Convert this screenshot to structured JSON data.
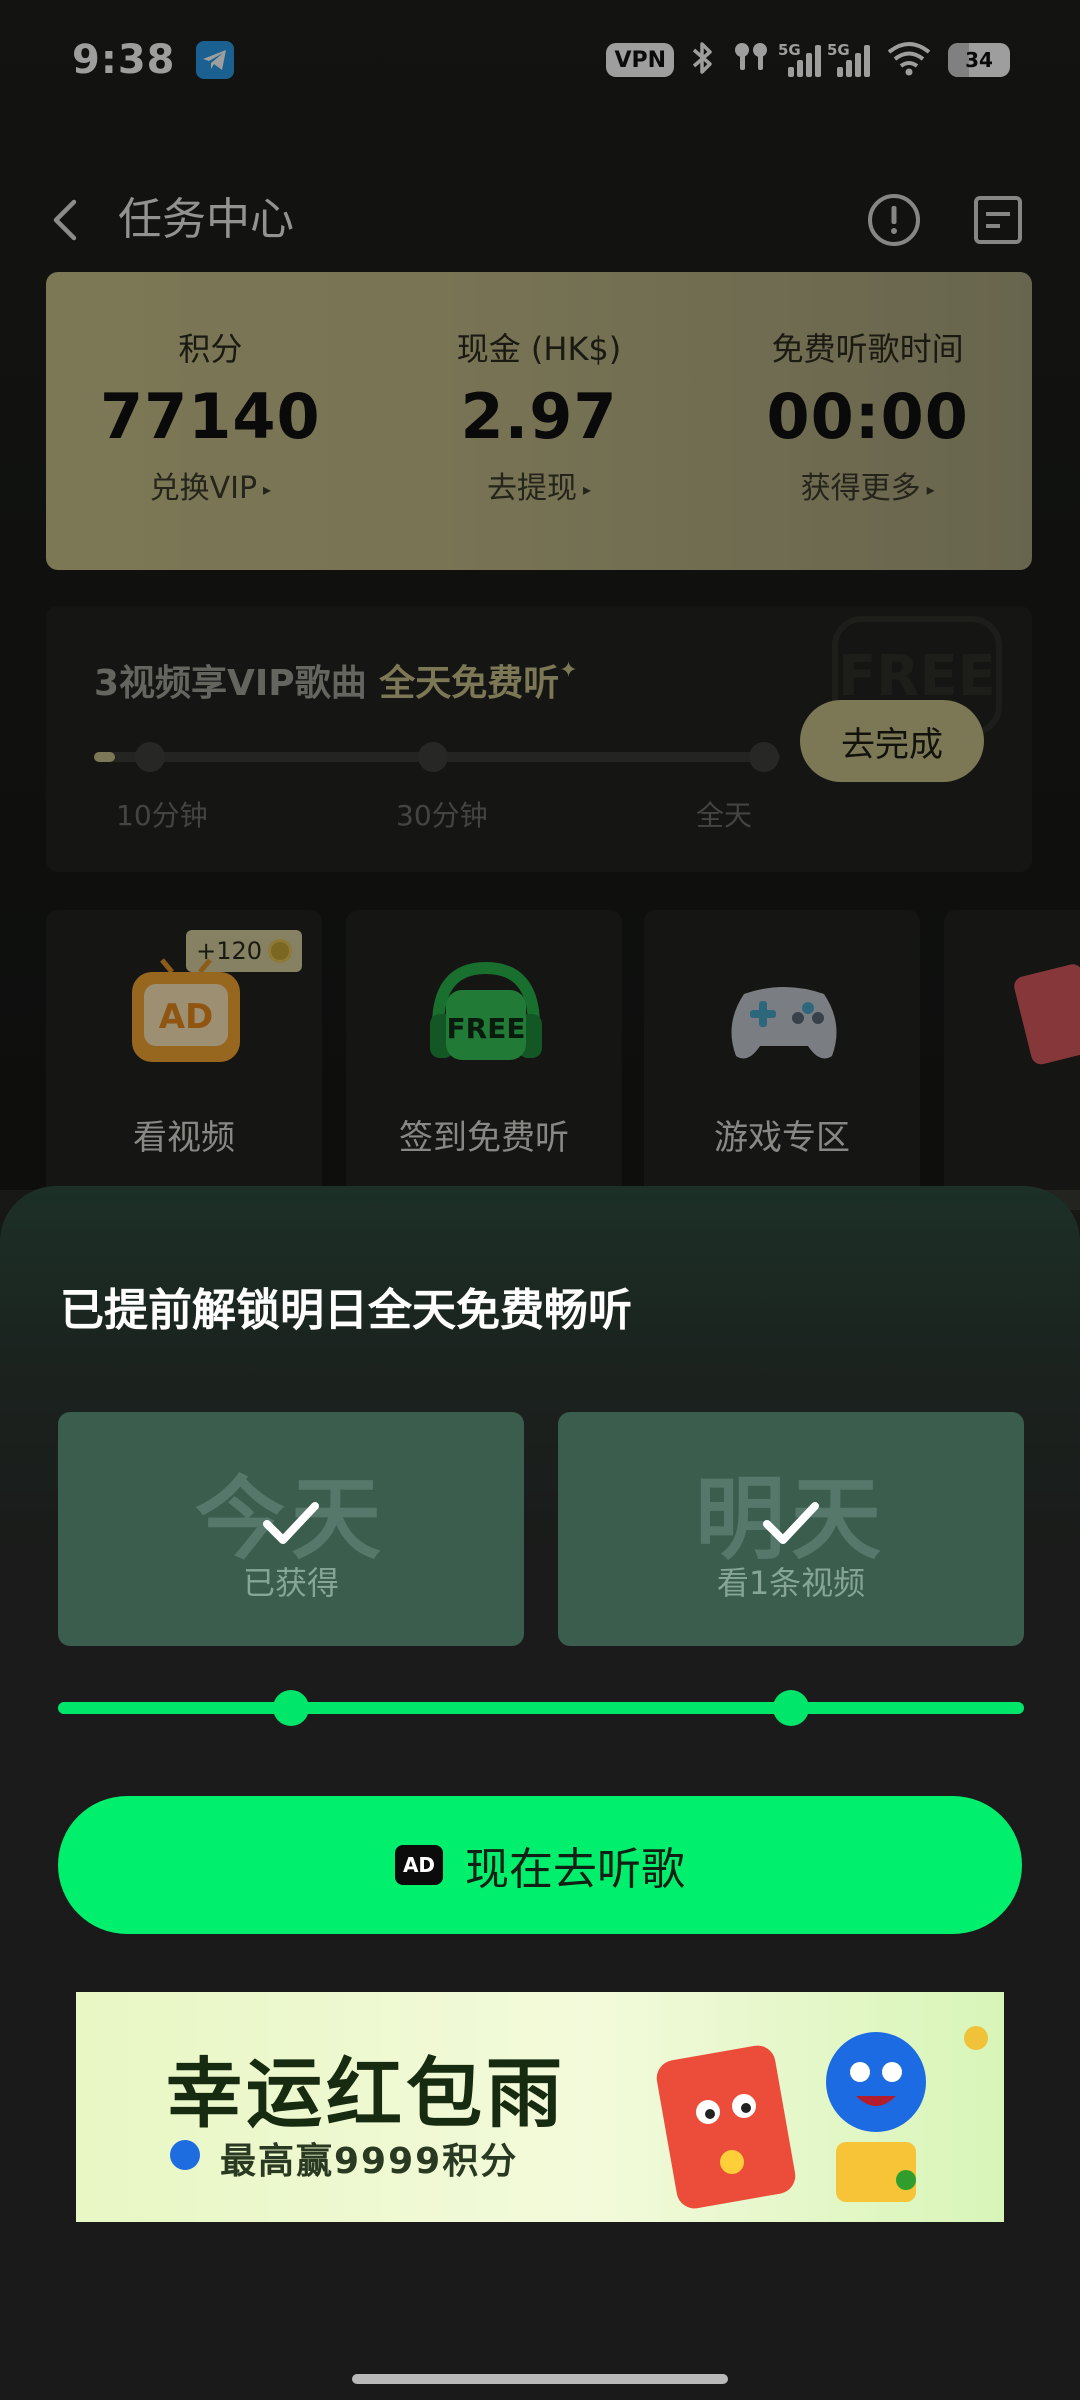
{
  "status_bar": {
    "time": "9:38",
    "vpn": "VPN",
    "signal_1_label": "5G",
    "signal_2_label": "5G",
    "battery": "34"
  },
  "header": {
    "title": "任务中心"
  },
  "stats": [
    {
      "label": "积分",
      "value": "77140",
      "link": "兑换VIP"
    },
    {
      "label": "现金 (HK$)",
      "value": "2.97",
      "link": "去提现"
    },
    {
      "label": "免费听歌时间",
      "value": "00:00",
      "link": "获得更多"
    }
  ],
  "vip_task": {
    "title_part1": "3视频享VIP歌曲",
    "title_part2": "全天免费听",
    "button": "去完成",
    "milestones": [
      "10分钟",
      "30分钟",
      "全天"
    ],
    "progress_fraction": 0.03
  },
  "tiles": [
    {
      "label": "看视频",
      "badge": "+120",
      "icon": "ad-tv-icon"
    },
    {
      "label": "签到免费听",
      "icon": "free-headphones-icon"
    },
    {
      "label": "游戏专区",
      "icon": "gamepad-icon"
    }
  ],
  "sheet": {
    "title": "已提前解锁明日全天免费畅听",
    "days": [
      {
        "name": "今天",
        "sub": "已获得",
        "done": true
      },
      {
        "name": "明天",
        "sub": "看1条视频",
        "done": true
      }
    ],
    "button_ad": "AD",
    "button": "现在去听歌"
  },
  "promo": {
    "title": "幸运红包雨",
    "subtitle": "最高赢9999积分"
  },
  "colors": {
    "accent_green": "#00f06e",
    "gold": "#c9c18a",
    "card_green": "#3a5d4d"
  }
}
